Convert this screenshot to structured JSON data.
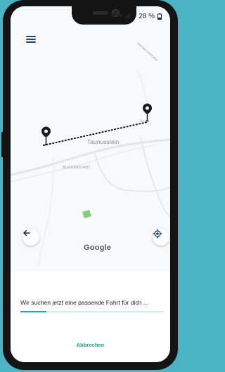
{
  "status_bar": {
    "battery": "28 %",
    "icons": [
      "location-icon",
      "wifi-icon",
      "signal-icon",
      "battery-icon"
    ]
  },
  "map": {
    "city_label": "Taunusstein",
    "district_label": "BLEIDENSTADT",
    "street_label": "Sonnenhofstraße",
    "pin_label": "HAHN",
    "attribution": "Google",
    "colors": {
      "route_dots": "#1a1a1a",
      "park": "#7ed07e"
    }
  },
  "bottom_sheet": {
    "search_text": "Wir suchen jetzt eine passende Fahrt für dich ...",
    "progress": 0.18,
    "cancel_label": "Abbrechen"
  },
  "colors": {
    "accent": "#18a9a9",
    "cancel": "#1aa37a",
    "background": "#4cb3c4"
  }
}
